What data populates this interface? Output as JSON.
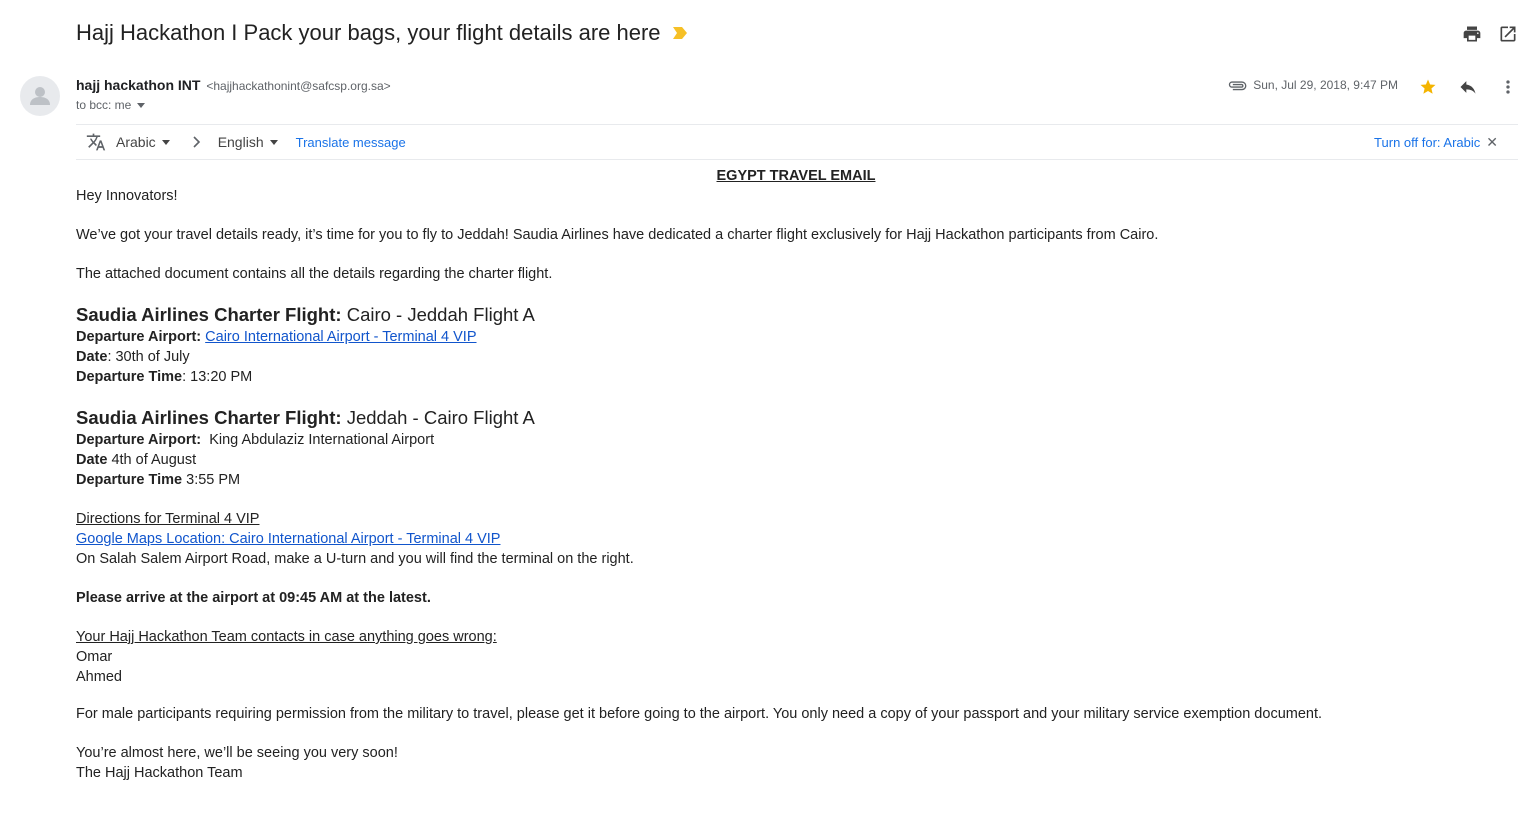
{
  "subject": "Hajj Hackathon I Pack your bags, your flight details are here",
  "sender": {
    "name": "hajj hackathon INT",
    "email": "<hajjhackathonint@safcsp.org.sa>",
    "recipients": "to bcc: me",
    "date": "Sun, Jul 29, 2018, 9:47 PM"
  },
  "translate": {
    "from_lang": "Arabic",
    "to_lang": "English",
    "translate_label": "Translate message",
    "turn_off_label": "Turn off for: Arabic"
  },
  "body": {
    "heading": "EGYPT TRAVEL EMAIL",
    "greeting": "Hey Innovators!",
    "intro": "We’ve got your travel details ready, it’s time for you to fly to Jeddah! Saudia Airlines have dedicated a charter flight exclusively for Hajj Hackathon participants from Cairo.",
    "attached": "The attached document contains all the details regarding the charter flight.",
    "flight1": {
      "label": "Saudia Airlines Charter Flight:",
      "route": "Cairo - Jeddah Flight A",
      "dep_airport_label": "Departure Airport:",
      "dep_airport": "Cairo International Airport - Terminal 4 VIP",
      "date_label": "Date",
      "date": ": 30th of July",
      "time_label": "Departure Time",
      "time": ": 13:20 PM"
    },
    "flight2": {
      "label": "Saudia Airlines Charter Flight:",
      "route": "Jeddah - Cairo Flight A",
      "dep_airport_label": "Departure Airport:",
      "dep_airport": "King Abdulaziz International Airport",
      "date_label": "Date",
      "date": "4th of August",
      "time_label": "Departure Time",
      "time": "3:55 PM"
    },
    "directions_title": "Directions for Terminal 4 VIP",
    "maps_link": "Google Maps Location: Cairo International Airport - Terminal 4 VIP",
    "directions_text": "On Salah Salem Airport Road, make a U-turn and you will find the terminal on the right.",
    "arrive_note": "Please arrive at the airport at 09:45 AM at the latest.",
    "contacts_title": "Your Hajj Hackathon Team contacts in case anything goes wrong:",
    "contacts": [
      "Omar",
      "Ahmed"
    ],
    "military_note": "For male participants requiring permission from the military to travel, please get it before going to the airport. You only need a copy of your passport and your military service exemption document.",
    "closing": "You’re almost here, we’ll be seeing you very soon!",
    "signature": "The Hajj Hackathon Team"
  },
  "colors": {
    "link": "#1155cc",
    "accent_blue": "#1a73e8",
    "star": "#f4b400",
    "important": "#f6c026"
  },
  "icons": [
    "important-marker-icon",
    "print-icon",
    "open-new-window-icon",
    "avatar-icon",
    "attachment-icon",
    "star-icon",
    "reply-icon",
    "more-vert-icon",
    "translate-icon",
    "chevron-right-icon",
    "close-icon"
  ]
}
